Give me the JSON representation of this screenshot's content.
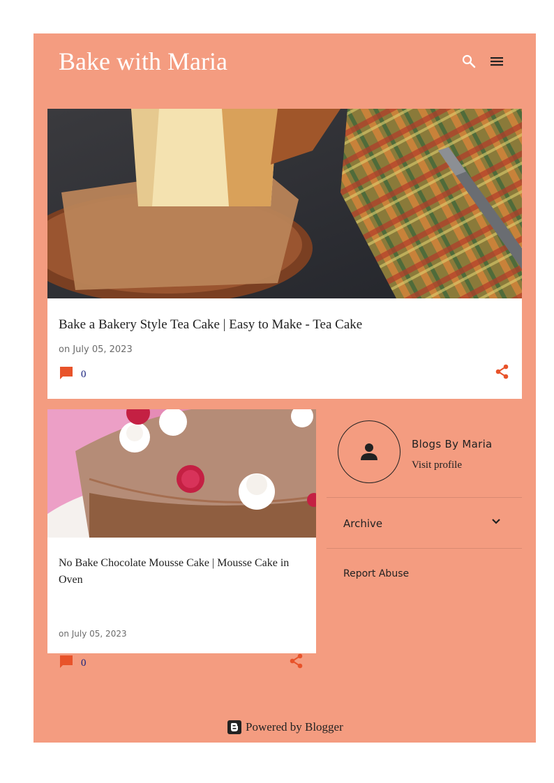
{
  "header": {
    "title": "Bake with Maria",
    "icons": [
      "search-icon",
      "menu-icon"
    ]
  },
  "posts": [
    {
      "title": "Bake a Bakery Style Tea Cake | Easy to Make - Tea Cake",
      "date": "on July 05, 2023",
      "comments": "0",
      "image": "tea-cake-photo"
    },
    {
      "title": "No Bake Chocolate Mousse Cake | Mousse Cake in Oven",
      "date": "on July 05, 2023",
      "comments": "0",
      "image": "mousse-cake-photo"
    }
  ],
  "profile": {
    "name": "Blogs By Maria",
    "link": "Visit profile"
  },
  "archive": {
    "label": "Archive"
  },
  "report_abuse": "Report Abuse",
  "footer": {
    "powered": "Powered by Blogger"
  },
  "colors": {
    "background": "#f49c80",
    "accent": "#e8532a",
    "header_text": "#ffffff"
  }
}
